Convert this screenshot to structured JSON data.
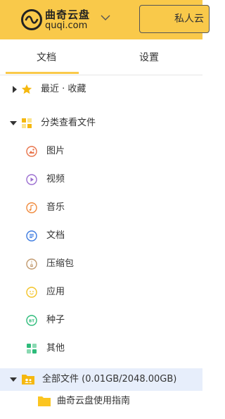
{
  "header": {
    "logo_cn": "曲奇云盘",
    "logo_en": "quqi.com",
    "private_button": "私人云"
  },
  "tabs": [
    {
      "label": "文档",
      "active": true
    },
    {
      "label": "设置",
      "active": false
    }
  ],
  "tree": {
    "recent": "最近 · 收藏",
    "categories": "分类查看文件",
    "category_items": [
      {
        "label": "图片",
        "icon": "image-icon"
      },
      {
        "label": "视频",
        "icon": "video-icon"
      },
      {
        "label": "音乐",
        "icon": "music-icon"
      },
      {
        "label": "文档",
        "icon": "document-icon"
      },
      {
        "label": "压缩包",
        "icon": "archive-icon"
      },
      {
        "label": "应用",
        "icon": "app-icon"
      },
      {
        "label": "种子",
        "icon": "torrent-icon"
      },
      {
        "label": "其他",
        "icon": "other-icon"
      }
    ],
    "all_files": "全部文件 (0.01GB/2048.00GB)",
    "all_files_children": [
      {
        "label": "曲奇云盘使用指南",
        "icon": "folder-icon"
      }
    ]
  },
  "colors": {
    "brand_yellow": "#f9c94a",
    "selected_row": "#e7eefb"
  }
}
